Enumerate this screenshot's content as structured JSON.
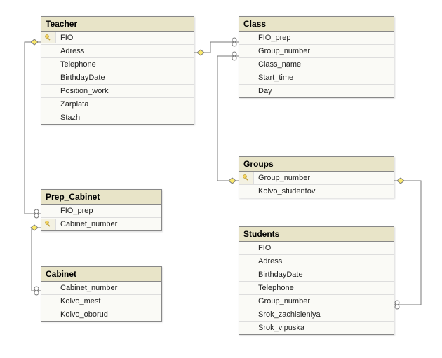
{
  "entities": {
    "teacher": {
      "title": "Teacher",
      "columns": [
        {
          "name": "FIO",
          "pk": true
        },
        {
          "name": "Adress",
          "pk": false
        },
        {
          "name": "Telephone",
          "pk": false
        },
        {
          "name": "BirthdayDate",
          "pk": false
        },
        {
          "name": "Position_work",
          "pk": false
        },
        {
          "name": "Zarplata",
          "pk": false
        },
        {
          "name": "Stazh",
          "pk": false
        }
      ]
    },
    "class": {
      "title": "Class",
      "columns": [
        {
          "name": "FIO_prep",
          "pk": false
        },
        {
          "name": "Group_number",
          "pk": false
        },
        {
          "name": "Class_name",
          "pk": false
        },
        {
          "name": "Start_time",
          "pk": false
        },
        {
          "name": "Day",
          "pk": false
        }
      ]
    },
    "prep_cabinet": {
      "title": "Prep_Cabinet",
      "columns": [
        {
          "name": "FIO_prep",
          "pk": false
        },
        {
          "name": "Cabinet_number",
          "pk": true
        }
      ]
    },
    "groups": {
      "title": "Groups",
      "columns": [
        {
          "name": "Group_number",
          "pk": true
        },
        {
          "name": "Kolvo_studentov",
          "pk": false
        }
      ]
    },
    "cabinet": {
      "title": "Cabinet",
      "columns": [
        {
          "name": "Cabinet_number",
          "pk": false
        },
        {
          "name": "Kolvo_mest",
          "pk": false
        },
        {
          "name": "Kolvo_oborud",
          "pk": false
        }
      ]
    },
    "students": {
      "title": "Students",
      "columns": [
        {
          "name": "FIO",
          "pk": false
        },
        {
          "name": "Adress",
          "pk": false
        },
        {
          "name": "BirthdayDate",
          "pk": false
        },
        {
          "name": "Telephone",
          "pk": false
        },
        {
          "name": "Group_number",
          "pk": false
        },
        {
          "name": "Srok_zachisleniya",
          "pk": false
        },
        {
          "name": "Srok_vipuska",
          "pk": false
        }
      ]
    }
  },
  "relationships": [
    {
      "from": "Teacher.FIO",
      "to": "Class.FIO_prep"
    },
    {
      "from": "Teacher.FIO",
      "to": "Prep_Cabinet.FIO_prep"
    },
    {
      "from": "Prep_Cabinet.Cabinet_number",
      "to": "Cabinet.Cabinet_number"
    },
    {
      "from": "Groups.Group_number",
      "to": "Class.Group_number"
    },
    {
      "from": "Groups.Group_number",
      "to": "Students.Group_number"
    }
  ]
}
